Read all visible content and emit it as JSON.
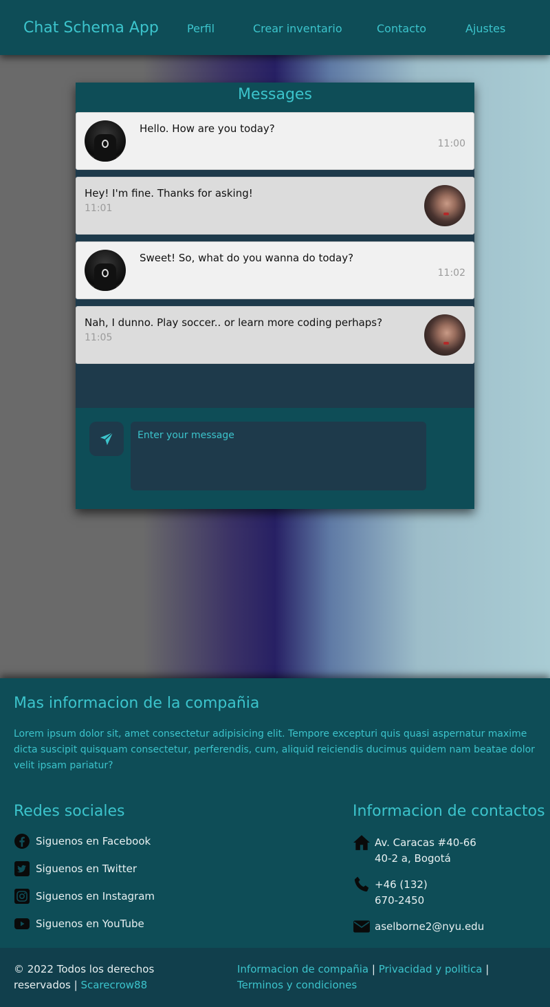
{
  "header": {
    "brand": "Chat Schema App",
    "nav": [
      "Perfil",
      "Crear inventario",
      "Contacto",
      "Ajustes"
    ]
  },
  "chat": {
    "title": "Messages",
    "messages": [
      {
        "side": "left",
        "text": "Hello. How are you today?",
        "time": "11:00"
      },
      {
        "side": "right",
        "text": "Hey! I'm fine. Thanks for asking!",
        "time": "11:01"
      },
      {
        "side": "left",
        "text": "Sweet! So, what do you wanna do today?",
        "time": "11:02"
      },
      {
        "side": "right",
        "text": "Nah, I dunno. Play soccer.. or learn more coding perhaps?",
        "time": "11:05"
      }
    ],
    "input_placeholder": "Enter your message",
    "input_value": ""
  },
  "footer": {
    "about_title": "Mas informacion de la compañia",
    "about_text": "Lorem ipsum dolor sit, amet consectetur adipisicing elit. Tempore excepturi quis quasi aspernatur maxime dicta suscipit quisquam consectetur, perferendis, cum, aliquid reiciendis ducimus quidem nam beatae dolor velit ipsam pariatur?",
    "social_title": "Redes sociales",
    "social": [
      {
        "label": "Siguenos en Facebook",
        "icon": "facebook-icon"
      },
      {
        "label": "Siguenos en Twitter",
        "icon": "twitter-icon"
      },
      {
        "label": "Siguenos en Instagram",
        "icon": "instagram-icon"
      },
      {
        "label": "Siguenos en YouTube",
        "icon": "youtube-icon"
      }
    ],
    "contact_title": "Informacion de contactos",
    "contact": {
      "address_1": "Av. Caracas #40-66",
      "address_2": "40-2 a, Bogotá",
      "phone_1": "+46 (132)",
      "phone_2": "670-2450",
      "email": "aselborne2@nyu.edu"
    }
  },
  "bottom": {
    "copyright": "© 2022 Todos los derechos reservados |",
    "author": "Scarecrow88",
    "links": [
      "Informacion de compañia",
      "Privacidad y politica",
      "Terminos y condiciones"
    ],
    "separator": "|"
  },
  "colors": {
    "accent": "#3cc4cc",
    "header_bg": "#0e4d57",
    "chat_bg": "#1e3a4b"
  }
}
